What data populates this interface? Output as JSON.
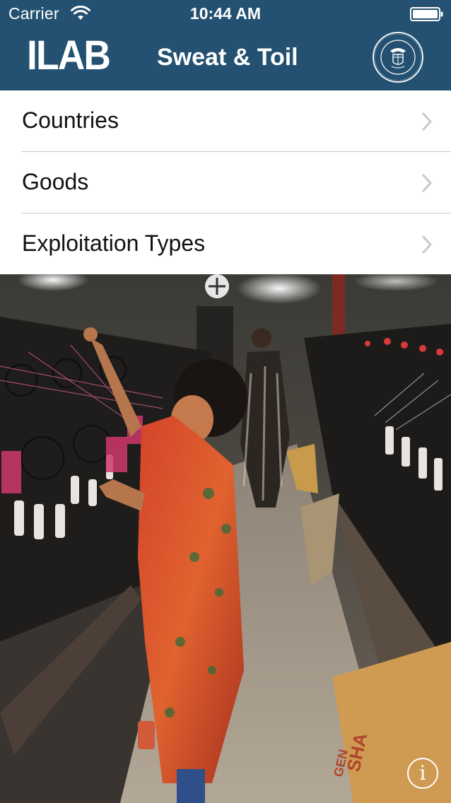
{
  "status_bar": {
    "carrier": "Carrier",
    "time": "10:44 AM"
  },
  "header": {
    "logo": "ILAB",
    "title": "Sweat & Toil",
    "seal_icon": "department-of-labor-seal-icon",
    "background": "#245171"
  },
  "menu": {
    "items": [
      {
        "label": "Countries",
        "icon": "chevron-right-icon"
      },
      {
        "label": "Goods",
        "icon": "chevron-right-icon"
      },
      {
        "label": "Exploitation Types",
        "icon": "chevron-right-icon"
      }
    ]
  },
  "photo": {
    "visible_text": [
      "SHA",
      "GEN"
    ]
  },
  "info_button": {
    "glyph": "i",
    "icon": "info-icon"
  }
}
